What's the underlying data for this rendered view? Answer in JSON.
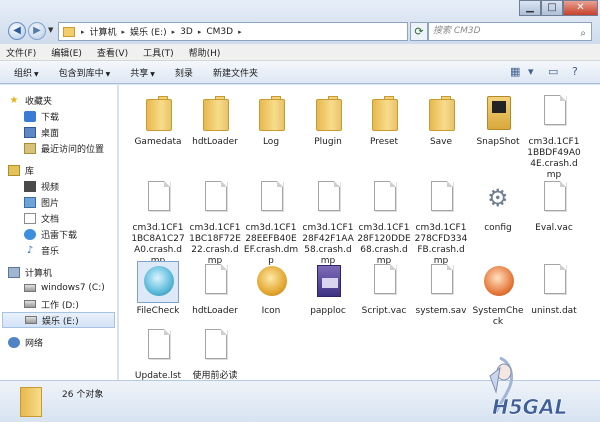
{
  "window": {
    "controls": {
      "minimize": "▁",
      "maximize": "□",
      "close": "✕"
    }
  },
  "address": {
    "crumbs": [
      "计算机",
      "娱乐 (E:)",
      "3D",
      "CM3D"
    ],
    "separator": "▸"
  },
  "search": {
    "placeholder": "搜索 CM3D",
    "icon": "search-icon"
  },
  "menu": [
    "文件(F)",
    "编辑(E)",
    "查看(V)",
    "工具(T)",
    "帮助(H)"
  ],
  "toolbar": {
    "organize": "组织",
    "include": "包含到库中",
    "share": "共享",
    "burn": "刻录",
    "new_folder": "新建文件夹",
    "caret": "▼"
  },
  "nav": {
    "favorites": {
      "label": "收藏夹",
      "items": [
        "下载",
        "桌面",
        "最近访问的位置"
      ]
    },
    "libraries": {
      "label": "库",
      "items": [
        "视频",
        "图片",
        "文档",
        "迅雷下载",
        "音乐"
      ]
    },
    "computer": {
      "label": "计算机",
      "items": [
        "windows7 (C:)",
        "工作 (D:)",
        "娱乐 (E:)"
      ]
    },
    "network": {
      "label": "网络"
    }
  },
  "files": [
    {
      "name": "Gamedata",
      "type": "folder"
    },
    {
      "name": "hdtLoader",
      "type": "folder"
    },
    {
      "name": "Log",
      "type": "folder"
    },
    {
      "name": "Plugin",
      "type": "folder"
    },
    {
      "name": "Preset",
      "type": "folder"
    },
    {
      "name": "Save",
      "type": "folder"
    },
    {
      "name": "SnapShot",
      "type": "snapshot"
    },
    {
      "name": "cm3d.1CF11BBDF49A04E.crash.dmp",
      "type": "doc"
    },
    {
      "name": "cm3d.1CF11BC8A1C27A0.crash.dmp",
      "type": "doc"
    },
    {
      "name": "cm3d.1CF11BC18F72E22.crash.dmp",
      "type": "doc"
    },
    {
      "name": "cm3d.1CF128EEFB40EEF.crash.dmp",
      "type": "doc"
    },
    {
      "name": "cm3d.1CF128F42F1AA58.crash.dmp",
      "type": "doc"
    },
    {
      "name": "cm3d.1CF128F120DDE68.crash.dmp",
      "type": "doc"
    },
    {
      "name": "cm3d.1CF1278CFD334FB.crash.dmp",
      "type": "doc"
    },
    {
      "name": "config",
      "type": "gear"
    },
    {
      "name": "Eval.vac",
      "type": "doc"
    },
    {
      "name": "FileCheck",
      "type": "app-blue"
    },
    {
      "name": "hdtLoader",
      "type": "doc"
    },
    {
      "name": "Icon",
      "type": "app-gold"
    },
    {
      "name": "papploc",
      "type": "installer"
    },
    {
      "name": "Script.vac",
      "type": "doc"
    },
    {
      "name": "system.sav",
      "type": "doc"
    },
    {
      "name": "SystemCheck",
      "type": "app-red"
    },
    {
      "name": "uninst.dat",
      "type": "doc"
    },
    {
      "name": "Update.lst",
      "type": "doc"
    },
    {
      "name": "使用前必读",
      "type": "doc"
    }
  ],
  "status": {
    "count": "26 个对象"
  },
  "watermark": "H5GAL",
  "colors": {
    "accent": "#3a6ea5",
    "folder": "#f2cd6a"
  }
}
